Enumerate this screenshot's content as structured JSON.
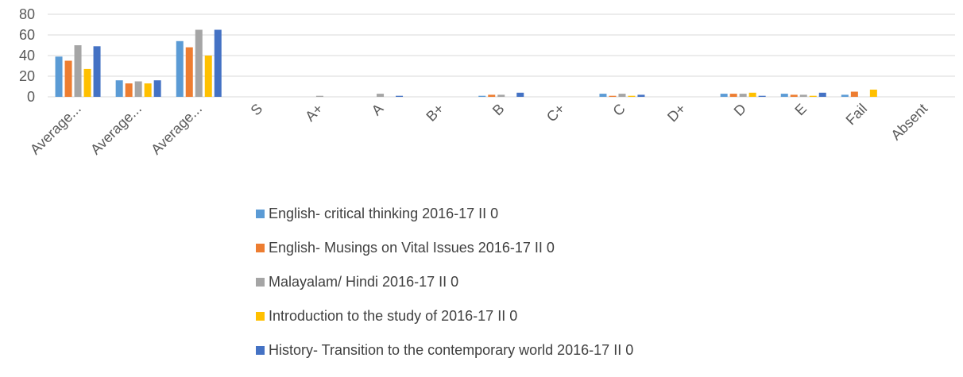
{
  "chart_data": {
    "type": "bar",
    "title": "",
    "xlabel": "",
    "ylabel": "",
    "ylim": [
      0,
      80
    ],
    "yticks": [
      0,
      20,
      40,
      60,
      80
    ],
    "grid": true,
    "legend_position": "bottom",
    "categories": [
      "Average...",
      "Average...",
      "Average...",
      "S",
      "A+",
      "A",
      "B+",
      "B",
      "C+",
      "C",
      "D+",
      "D",
      "E",
      "Fail",
      "Absent"
    ],
    "series": [
      {
        "name": "English- critical thinking 2016-17 II 0",
        "color": "#5B9BD5",
        "values": [
          39,
          16,
          54,
          0,
          0,
          0,
          0,
          1,
          0,
          3,
          0,
          3,
          3,
          2,
          0
        ]
      },
      {
        "name": "English- Musings on Vital Issues 2016-17 II 0",
        "color": "#ED7D31",
        "values": [
          35,
          13,
          48,
          0,
          0,
          0,
          0,
          2,
          0,
          1,
          0,
          3,
          2,
          5,
          0
        ]
      },
      {
        "name": "Malayalam/ Hindi 2016-17 II 0",
        "color": "#A5A5A5",
        "values": [
          50,
          15,
          65,
          0,
          1,
          3,
          0,
          2,
          0,
          3,
          0,
          3,
          2,
          0,
          0
        ]
      },
      {
        "name": "Introduction to the study of 2016-17 II 0",
        "color": "#FFC000",
        "values": [
          27,
          13,
          40,
          0,
          0,
          0,
          0,
          0,
          0,
          1,
          0,
          4,
          1,
          7,
          0
        ]
      },
      {
        "name": "History- Transition to the contemporary world 2016-17 II 0",
        "color": "#4472C4",
        "values": [
          49,
          16,
          65,
          0,
          0,
          1,
          0,
          4,
          0,
          2,
          0,
          1,
          4,
          0,
          0
        ]
      }
    ]
  }
}
